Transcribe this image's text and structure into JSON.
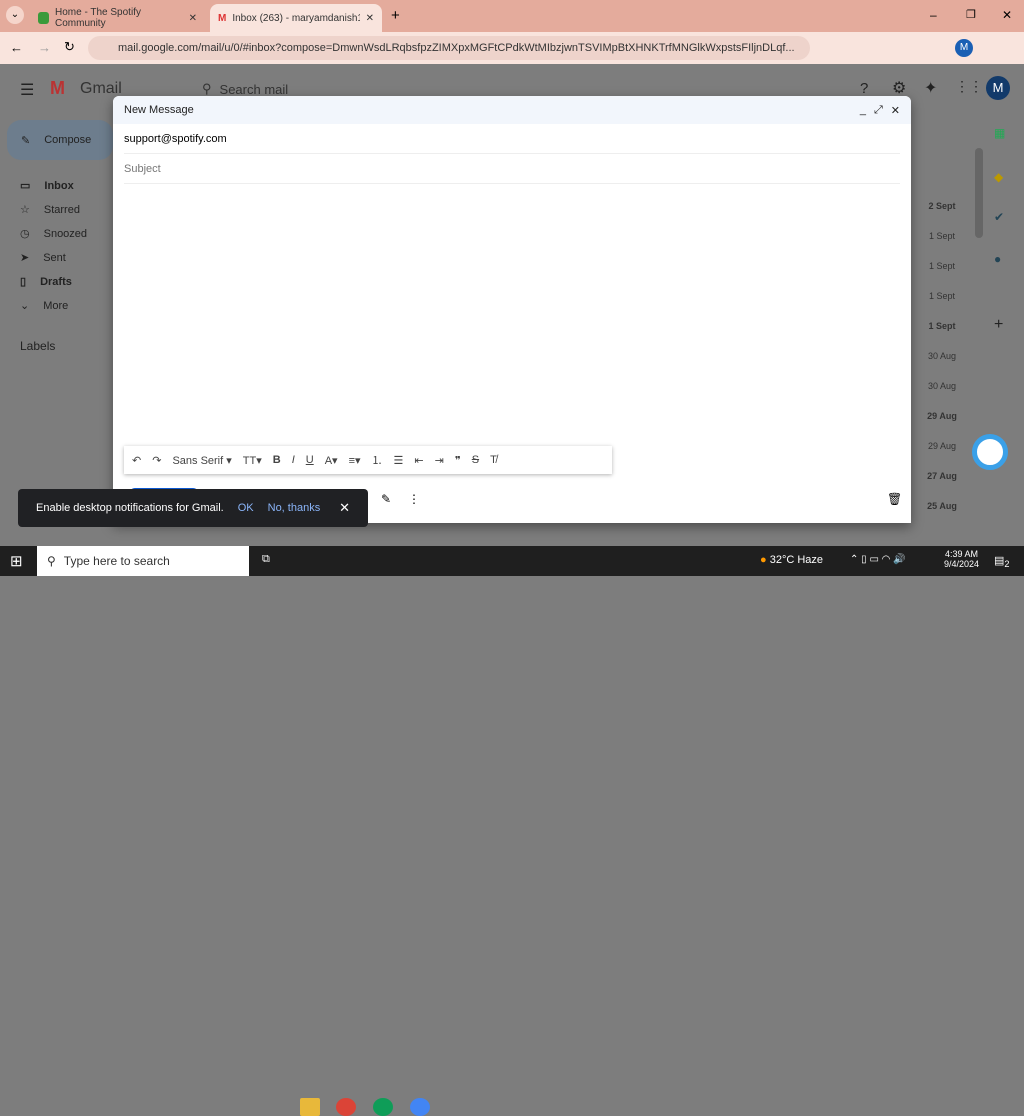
{
  "browser": {
    "tabs": [
      {
        "title": "Home - The Spotify Community",
        "icon": "spotify-community-icon"
      },
      {
        "title": "Inbox (263) - maryamdanish19…",
        "icon": "gmail-icon"
      }
    ],
    "url": "mail.google.com/mail/u/0/#inbox?compose=DmwnWsdLRqbsfpzZIMXpxMGFtCPdkWtMIbzjwnTSVIMpBtXHNKTrfMNGlkWxpstsFIljnDLqf...",
    "profile": "M"
  },
  "gmail": {
    "logo": "Gmail",
    "search_placeholder": "Search mail",
    "compose": "Compose",
    "sidebar": [
      {
        "label": "Inbox",
        "bold": true,
        "icon": "inbox-icon"
      },
      {
        "label": "Starred",
        "icon": "star-icon"
      },
      {
        "label": "Snoozed",
        "icon": "clock-icon"
      },
      {
        "label": "Sent",
        "icon": "send-icon"
      },
      {
        "label": "Drafts",
        "bold": true,
        "icon": "draft-icon"
      },
      {
        "label": "More",
        "icon": "chevron-down-icon"
      }
    ],
    "labels": "Labels",
    "dates": [
      {
        "d": "2 Sept",
        "b": true
      },
      {
        "d": "1 Sept"
      },
      {
        "d": "1 Sept"
      },
      {
        "d": "1 Sept"
      },
      {
        "d": "1 Sept",
        "b": true
      },
      {
        "d": "30 Aug"
      },
      {
        "d": "30 Aug"
      },
      {
        "d": "29 Aug",
        "b": true
      },
      {
        "d": "29 Aug"
      },
      {
        "d": "27 Aug",
        "b": true
      },
      {
        "d": "25 Aug",
        "b": true
      }
    ]
  },
  "compose": {
    "title": "New Message",
    "to": "support@spotify.com",
    "subject_placeholder": "Subject",
    "font": "Sans Serif"
  },
  "toast": {
    "text": "Enable desktop notifications for Gmail.",
    "ok": "OK",
    "no": "No, thanks"
  },
  "taskbar": {
    "search": "Type here to search",
    "weather": "32°C  Haze",
    "time": "4:39 AM",
    "date": "9/4/2024",
    "notifications": "2"
  }
}
